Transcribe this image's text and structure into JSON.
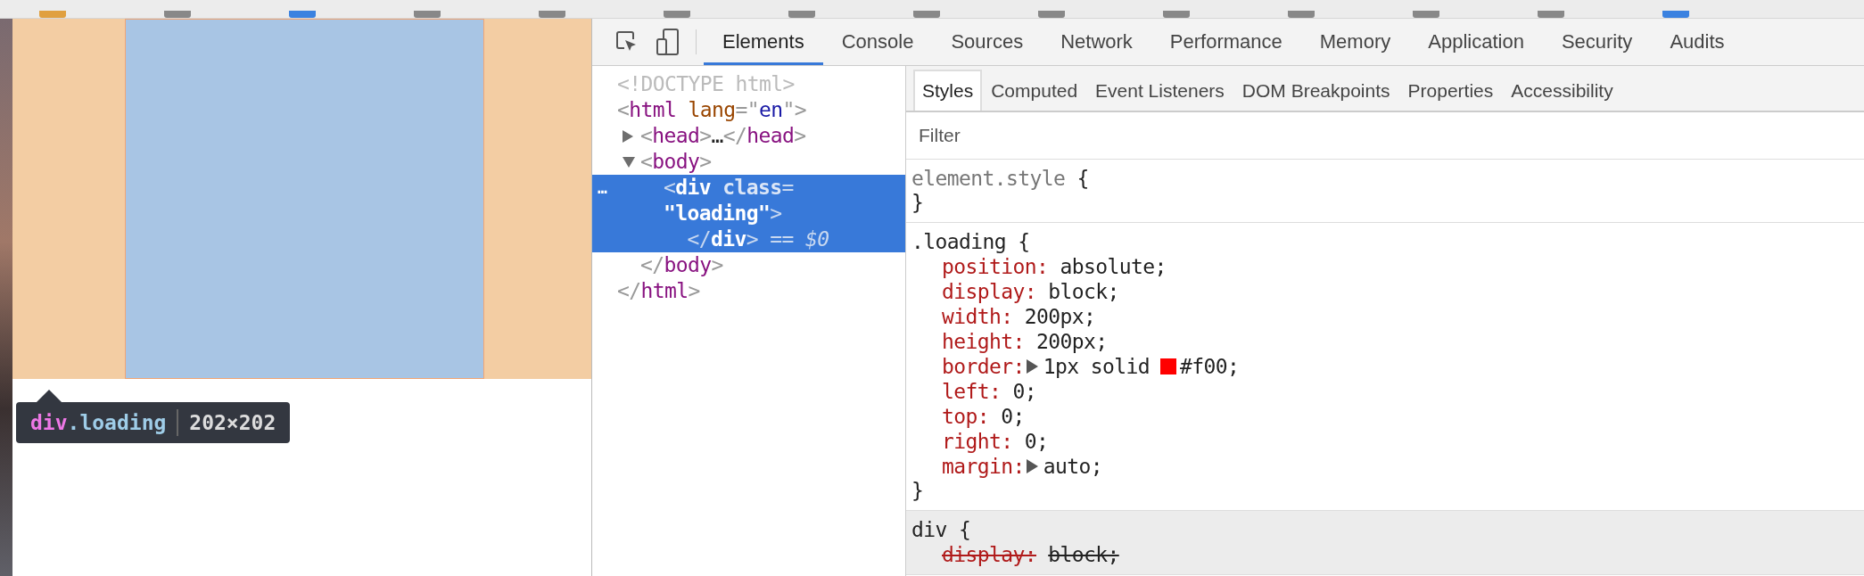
{
  "page_preview": {
    "tooltip": {
      "tag": "div",
      "class_name": ".loading",
      "size": "202×202"
    }
  },
  "devtools": {
    "tabs": [
      {
        "label": "Elements",
        "selected": true
      },
      {
        "label": "Console",
        "selected": false
      },
      {
        "label": "Sources",
        "selected": false
      },
      {
        "label": "Network",
        "selected": false
      },
      {
        "label": "Performance",
        "selected": false
      },
      {
        "label": "Memory",
        "selected": false
      },
      {
        "label": "Application",
        "selected": false
      },
      {
        "label": "Security",
        "selected": false
      },
      {
        "label": "Audits",
        "selected": false
      }
    ],
    "dom_tree": [
      {
        "selected": false,
        "lines": [
          [
            {
              "kind": "doctype",
              "text": "<!DOCTYPE html>"
            }
          ]
        ]
      },
      {
        "selected": false,
        "lines": [
          [
            {
              "kind": "punct",
              "text": "<"
            },
            {
              "kind": "tag",
              "text": "html"
            },
            {
              "kind": "attr",
              "text": " lang"
            },
            {
              "kind": "punct",
              "text": "=\""
            },
            {
              "kind": "value",
              "text": "en"
            },
            {
              "kind": "punct",
              "text": "\">"
            }
          ]
        ],
        "close": [
          {
            "kind": "punct",
            "text": "</"
          },
          {
            "kind": "tag",
            "text": "html"
          },
          {
            "kind": "punct",
            "text": ">"
          }
        ],
        "children": [
          {
            "selected": false,
            "expanded": false,
            "lines": [
              [
                {
                  "kind": "punct",
                  "text": "<"
                },
                {
                  "kind": "tag",
                  "text": "head"
                },
                {
                  "kind": "punct",
                  "text": ">"
                },
                {
                  "kind": "plain",
                  "text": "…"
                },
                {
                  "kind": "punct",
                  "text": "</"
                },
                {
                  "kind": "tag",
                  "text": "head"
                },
                {
                  "kind": "punct",
                  "text": ">"
                }
              ]
            ]
          },
          {
            "selected": false,
            "expanded": true,
            "lines": [
              [
                {
                  "kind": "punct",
                  "text": "<"
                },
                {
                  "kind": "tag",
                  "text": "body"
                },
                {
                  "kind": "punct",
                  "text": ">"
                }
              ]
            ],
            "close": [
              {
                "kind": "punct",
                "text": "</"
              },
              {
                "kind": "tag",
                "text": "body"
              },
              {
                "kind": "punct",
                "text": ">"
              }
            ],
            "children": [
              {
                "selected": true,
                "gutter": "…",
                "lines": [
                  [
                    {
                      "kind": "punct",
                      "text": "<"
                    },
                    {
                      "kind": "tag",
                      "text": "div"
                    },
                    {
                      "kind": "attr",
                      "text": " class"
                    },
                    {
                      "kind": "punct",
                      "text": "="
                    }
                  ],
                  [
                    {
                      "kind": "value",
                      "text": "\"loading\""
                    },
                    {
                      "kind": "punct",
                      "text": ">"
                    }
                  ],
                  [
                    {
                      "kind": "punct",
                      "text": "  </"
                    },
                    {
                      "kind": "tag",
                      "text": "div"
                    },
                    {
                      "kind": "punct",
                      "text": ">"
                    },
                    {
                      "kind": "ref",
                      "text": " == $0"
                    }
                  ]
                ]
              }
            ]
          }
        ]
      }
    ],
    "style_tabs": [
      {
        "label": "Styles",
        "selected": true
      },
      {
        "label": "Computed",
        "selected": false
      },
      {
        "label": "Event Listeners",
        "selected": false
      },
      {
        "label": "DOM Breakpoints",
        "selected": false
      },
      {
        "label": "Properties",
        "selected": false
      },
      {
        "label": "Accessibility",
        "selected": false
      }
    ],
    "filter": {
      "placeholder": "Filter"
    },
    "rules": [
      {
        "selector": "element.style",
        "open": "{",
        "close": "}",
        "inline": true,
        "user_agent": false
      },
      {
        "selector": ".loading",
        "open": "{",
        "close": "}",
        "inline": false,
        "user_agent": false,
        "properties": [
          {
            "name": "position:",
            "value": "absolute;",
            "expandable": false,
            "overridden": false
          },
          {
            "name": "display:",
            "value": "block;",
            "expandable": false,
            "overridden": false
          },
          {
            "name": "width:",
            "value": "200px;",
            "expandable": false,
            "overridden": false
          },
          {
            "name": "height:",
            "value": "200px;",
            "expandable": false,
            "overridden": false
          },
          {
            "name": "border:",
            "value": "1px solid",
            "color": "#ff0000",
            "color_text": "#f00;",
            "expandable": true,
            "overridden": false
          },
          {
            "name": "left:",
            "value": "0;",
            "expandable": false,
            "overridden": false
          },
          {
            "name": "top:",
            "value": "0;",
            "expandable": false,
            "overridden": false
          },
          {
            "name": "right:",
            "value": "0;",
            "expandable": false,
            "overridden": false
          },
          {
            "name": "margin:",
            "value": "auto;",
            "expandable": true,
            "overridden": false
          }
        ]
      },
      {
        "selector": "div",
        "open": "{",
        "inline": false,
        "user_agent": true,
        "properties": [
          {
            "name": "display:",
            "value": "block;",
            "expandable": false,
            "overridden": true
          }
        ]
      }
    ]
  }
}
